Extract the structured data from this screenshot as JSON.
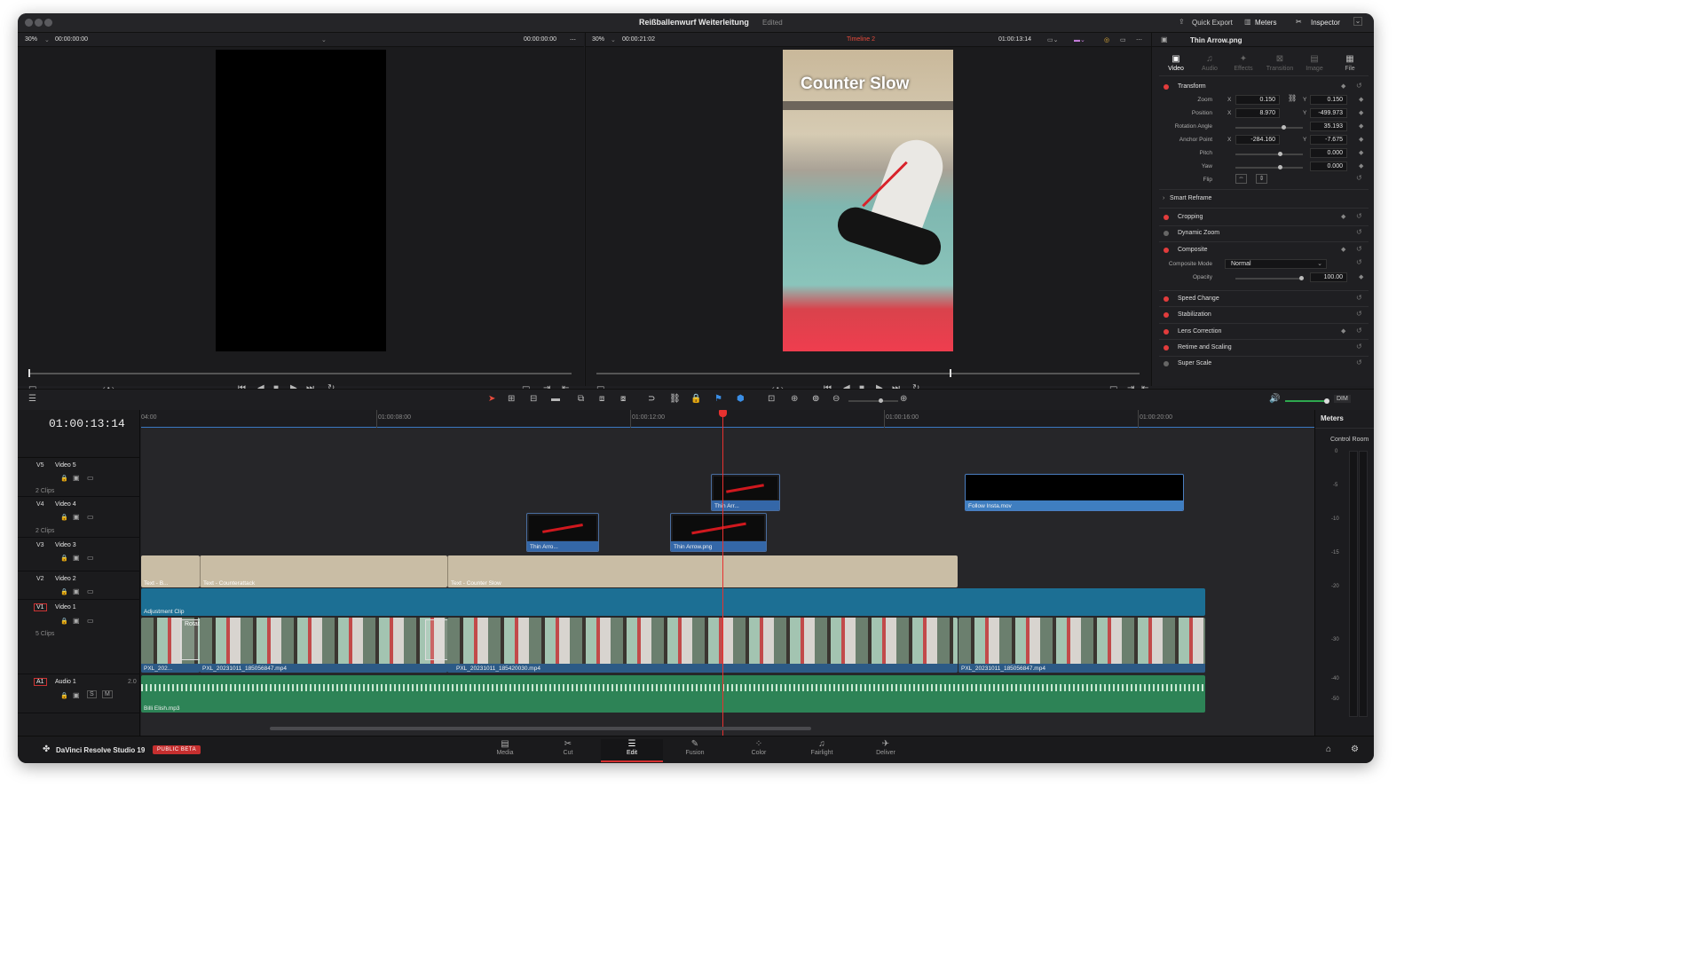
{
  "window": {
    "project_title": "Reißballenwurf Weiterleitung",
    "project_status": "Edited",
    "quick_export": "Quick Export",
    "meters": "Meters",
    "inspector": "Inspector"
  },
  "source_viewer": {
    "zoom": "30%",
    "timecode_left": "00:00:00:00",
    "timecode_right": "00:00:00:00"
  },
  "timeline_viewer": {
    "zoom": "30%",
    "duration": "00:00:21:02",
    "timeline_name": "Timeline 2",
    "timecode": "01:00:13:14",
    "overlay_text": "Counter Slow",
    "playhead_fraction": 0.65
  },
  "inspector": {
    "clip_name": "Thin Arrow.png",
    "tabs": [
      "Video",
      "Audio",
      "Effects",
      "Transition",
      "Image",
      "File"
    ],
    "transform": {
      "label": "Transform",
      "zoom_label": "Zoom",
      "zoom_x": "0.150",
      "zoom_y": "0.150",
      "position_label": "Position",
      "position_x": "8.970",
      "position_y": "-499.973",
      "rotation_label": "Rotation Angle",
      "rotation": "35.193",
      "anchor_label": "Anchor Point",
      "anchor_x": "-284.160",
      "anchor_y": "-7.675",
      "pitch_label": "Pitch",
      "pitch": "0.000",
      "yaw_label": "Yaw",
      "yaw": "0.000",
      "flip_label": "Flip",
      "x": "X",
      "y": "Y"
    },
    "smart_reframe": "Smart Reframe",
    "cropping": "Cropping",
    "dynamic_zoom": "Dynamic Zoom",
    "composite": {
      "label": "Composite",
      "mode_label": "Composite Mode",
      "mode_value": "Normal",
      "opacity_label": "Opacity",
      "opacity_value": "100.00"
    },
    "sections": [
      "Speed Change",
      "Stabilization",
      "Lens Correction",
      "Retime and Scaling",
      "Super Scale"
    ]
  },
  "timeline": {
    "timecode": "01:00:13:14",
    "ruler": [
      "04:00",
      "01:00:08:00",
      "01:00:12:00",
      "01:00:16:00",
      "01:00:20:00"
    ],
    "dim_label": "DIM",
    "tracks": [
      {
        "id": "V5",
        "name": "Video 5",
        "clips": "2 Clips"
      },
      {
        "id": "V4",
        "name": "Video 4",
        "clips": "2 Clips"
      },
      {
        "id": "V3",
        "name": "Video 3",
        "clips": ""
      },
      {
        "id": "V2",
        "name": "Video 2",
        "clips": ""
      },
      {
        "id": "V1",
        "name": "Video 1",
        "clips": "5 Clips"
      },
      {
        "id": "A1",
        "name": "Audio 1",
        "clips": "",
        "channels": "2.0"
      }
    ],
    "clip_labels": {
      "v5_arrow": "Thin Arr...",
      "v5_follow": "Follow Insta.mov",
      "v4_arrow1": "Thin Arro...",
      "v4_arrow2": "Thin Arrow.png",
      "v3_text1": "Text - B...",
      "v3_text2": "Text - Counterattack",
      "v3_text3": "Text - Counter Slow",
      "v2_adj": "Adjustment Clip",
      "v1_c1": "PXL_202...",
      "v1_c2": "PXL_20231011_185056847.mp4",
      "v1_c3": "PXL_20231011_185420030.mp4",
      "v1_c4": "PXL_20231011_185056847.mp4",
      "v1_rotate": "Rotate",
      "a1": "Billi Elish.mp3"
    },
    "audio_solo": "S",
    "audio_mute": "M"
  },
  "meters_panel": {
    "title": "Meters",
    "subtitle": "Control Room",
    "scale": [
      "0",
      "-5",
      "-10",
      "-15",
      "-20",
      "-30",
      "-40",
      "-50"
    ]
  },
  "footer": {
    "app_name": "DaVinci Resolve Studio 19",
    "badge": "PUBLIC BETA",
    "pages": [
      "Media",
      "Cut",
      "Edit",
      "Fusion",
      "Color",
      "Fairlight",
      "Deliver"
    ],
    "active_page": "Edit"
  },
  "colors": {
    "accent_red": "#d32f2f",
    "adjustment_clip": "#1c6f94",
    "text_clip": "#c9bda5",
    "audio_clip": "#2d8356",
    "follow_clip": "#3f7ec0"
  }
}
